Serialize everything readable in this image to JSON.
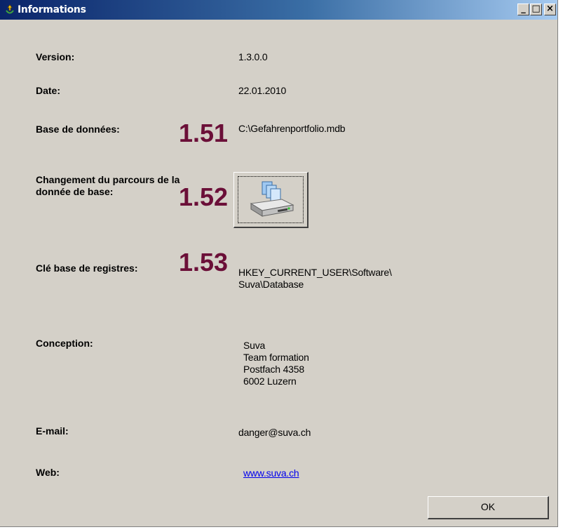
{
  "window": {
    "title": "Informations",
    "min_label": "_",
    "max_label": "□",
    "close_label": "×"
  },
  "fields": {
    "version": {
      "label": "Version:",
      "value": "1.3.0.0"
    },
    "date": {
      "label": "Date:",
      "value": "22.01.2010"
    },
    "database": {
      "label": "Base de données:",
      "marker": "1.51",
      "value": "C:\\Gefahrenportfolio.mdb"
    },
    "change_path": {
      "label": "Changement du parcours de la\ndonnée de base:",
      "marker": "1.52"
    },
    "registry": {
      "label": "Clé base de registres:",
      "marker": "1.53",
      "value": "HKEY_CURRENT_USER\\Software\\\nSuva\\Database"
    },
    "conception": {
      "label": "Conception:",
      "value": "Suva\nTeam formation\nPostfach 4358\n6002 Luzern"
    },
    "email": {
      "label": "E-mail:",
      "value": "danger@suva.ch"
    },
    "web": {
      "label": "Web:",
      "value": "www.suva.ch"
    }
  },
  "buttons": {
    "ok": "OK"
  },
  "icons": {
    "title_icon": "app-icon",
    "path_button_icon": "database-drive-icon"
  },
  "colors": {
    "marker": "#6b0f38",
    "title_start": "#0a246a",
    "title_end": "#a6caf0",
    "window_bg": "#d4d0c8"
  }
}
